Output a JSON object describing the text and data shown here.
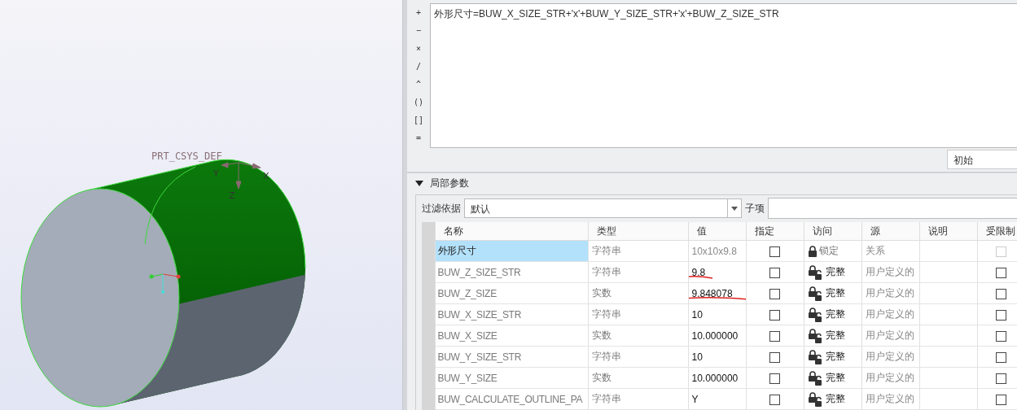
{
  "view": {
    "csys_label": "PRT_CSYS_DEF",
    "axes": [
      "Y",
      "X",
      "Z"
    ]
  },
  "operators": [
    "+",
    "−",
    "×",
    "/",
    "^",
    "()",
    "[]",
    "="
  ],
  "relation_text": "外形尺寸=BUW_X_SIZE_STR+'x'+BUW_Y_SIZE_STR+'x'+BUW_Z_SIZE_STR",
  "scope_dropdown": {
    "value": "初始"
  },
  "section": {
    "title": "局部参数",
    "expanded": true
  },
  "filter": {
    "label": "过滤依据",
    "value": "默认",
    "child_label": "子项"
  },
  "table": {
    "columns": [
      "名称",
      "类型",
      "值",
      "指定",
      "访问",
      "源",
      "说明",
      "受限制"
    ],
    "rows": [
      {
        "name": "外形尺寸",
        "type": "字符串",
        "value": "10x10x9.8",
        "designated": false,
        "kind": "locked",
        "access": "锁定",
        "source": "关系",
        "restricted": false,
        "selected": true,
        "marked": false
      },
      {
        "name": "BUW_Z_SIZE_STR",
        "type": "字符串",
        "value": "9.8",
        "designated": false,
        "kind": "full",
        "access": "完整",
        "source": "用户定义的",
        "restricted": false,
        "selected": false,
        "marked": true
      },
      {
        "name": "BUW_Z_SIZE",
        "type": "实数",
        "value": "9.848078",
        "designated": false,
        "kind": "full",
        "access": "完整",
        "source": "用户定义的",
        "restricted": false,
        "selected": false,
        "marked": true
      },
      {
        "name": "BUW_X_SIZE_STR",
        "type": "字符串",
        "value": "10",
        "designated": false,
        "kind": "full",
        "access": "完整",
        "source": "用户定义的",
        "restricted": false,
        "selected": false,
        "marked": false
      },
      {
        "name": "BUW_X_SIZE",
        "type": "实数",
        "value": "10.000000",
        "designated": false,
        "kind": "full",
        "access": "完整",
        "source": "用户定义的",
        "restricted": false,
        "selected": false,
        "marked": false
      },
      {
        "name": "BUW_Y_SIZE_STR",
        "type": "字符串",
        "value": "10",
        "designated": false,
        "kind": "full",
        "access": "完整",
        "source": "用户定义的",
        "restricted": false,
        "selected": false,
        "marked": false
      },
      {
        "name": "BUW_Y_SIZE",
        "type": "实数",
        "value": "10.000000",
        "designated": false,
        "kind": "full",
        "access": "完整",
        "source": "用户定义的",
        "restricted": false,
        "selected": false,
        "marked": false
      },
      {
        "name": "BUW_CALCULATE_OUTLINE_PA",
        "type": "字符串",
        "value": "Y",
        "designated": false,
        "kind": "full",
        "access": "完整",
        "source": "用户定义的",
        "restricted": false,
        "selected": false,
        "marked": false
      }
    ]
  }
}
